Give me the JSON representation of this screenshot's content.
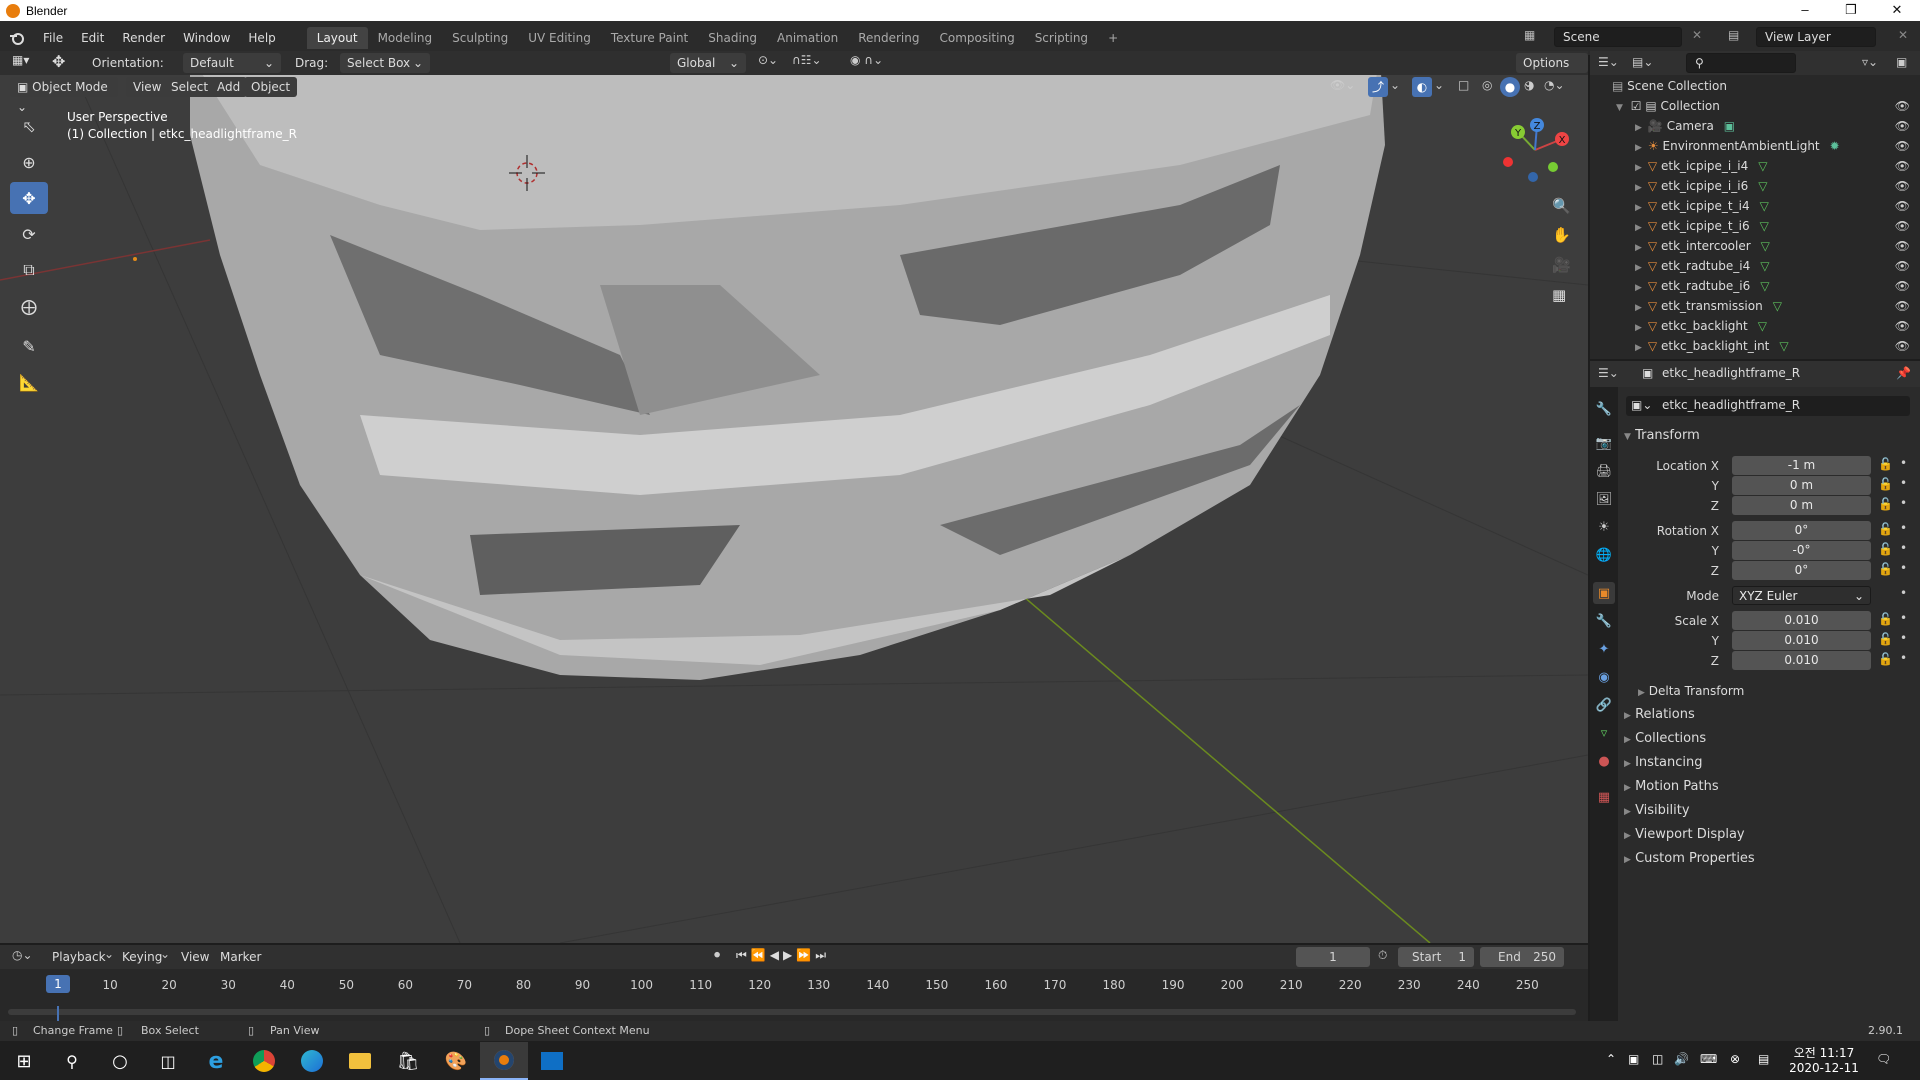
{
  "window": {
    "title": "Blender",
    "minimize": "–",
    "maximize": "❒",
    "close": "✕"
  },
  "menu": [
    "File",
    "Edit",
    "Render",
    "Window",
    "Help"
  ],
  "workspaces": [
    "Layout",
    "Modeling",
    "Sculpting",
    "UV Editing",
    "Texture Paint",
    "Shading",
    "Animation",
    "Rendering",
    "Compositing",
    "Scripting",
    "+"
  ],
  "active_workspace": "Layout",
  "scene": {
    "name": "Scene",
    "view_layer": "View Layer"
  },
  "tool_header": {
    "orientation_label": "Orientation:",
    "orientation_value": "Default",
    "drag_label": "Drag:",
    "drag_value": "Select Box",
    "transform_space": "Global",
    "options": "Options"
  },
  "viewport_header": {
    "mode": "Object Mode",
    "view": "View",
    "select": "Select",
    "add": "Add",
    "object": "Object"
  },
  "viewport": {
    "perspective": "User Perspective",
    "collection_info": "(1) Collection | etkc_headlightframe_R",
    "axis_x": "X",
    "axis_y": "Y",
    "axis_z": "Z"
  },
  "outliner": {
    "root": "Scene Collection",
    "collection": "Collection",
    "items": [
      {
        "name": "Camera",
        "type": "camera"
      },
      {
        "name": "EnvironmentAmbientLight",
        "type": "light"
      },
      {
        "name": "etk_icpipe_i_i4",
        "type": "mesh"
      },
      {
        "name": "etk_icpipe_i_i6",
        "type": "mesh"
      },
      {
        "name": "etk_icpipe_t_i4",
        "type": "mesh"
      },
      {
        "name": "etk_icpipe_t_i6",
        "type": "mesh"
      },
      {
        "name": "etk_intercooler",
        "type": "mesh"
      },
      {
        "name": "etk_radtube_i4",
        "type": "mesh"
      },
      {
        "name": "etk_radtube_i6",
        "type": "mesh"
      },
      {
        "name": "etk_transmission",
        "type": "mesh"
      },
      {
        "name": "etkc_backlight",
        "type": "mesh"
      },
      {
        "name": "etkc_backlight_int",
        "type": "mesh"
      }
    ]
  },
  "properties": {
    "context_object": "etkc_headlightframe_R",
    "object_name": "etkc_headlightframe_R",
    "transform_header": "Transform",
    "location": {
      "label_x": "Location X",
      "x": "-1 m",
      "y": "0 m",
      "z": "0 m"
    },
    "rotation": {
      "label_x": "Rotation X",
      "x": "0°",
      "y": "-0°",
      "z": "0°"
    },
    "mode_label": "Mode",
    "mode_value": "XYZ Euler",
    "scale": {
      "label_x": "Scale X",
      "x": "0.010",
      "y": "0.010",
      "z": "0.010"
    },
    "label_y": "Y",
    "label_z": "Z",
    "delta": "Delta Transform",
    "sections": [
      "Relations",
      "Collections",
      "Instancing",
      "Motion Paths",
      "Visibility",
      "Viewport Display",
      "Custom Properties"
    ]
  },
  "timeline": {
    "playback": "Playback",
    "keying": "Keying",
    "view": "View",
    "marker": "Marker",
    "current_frame": "1",
    "start_label": "Start",
    "start": "1",
    "end_label": "End",
    "end": "250",
    "ticks": [
      "10",
      "20",
      "30",
      "40",
      "50",
      "60",
      "70",
      "80",
      "90",
      "100",
      "110",
      "120",
      "130",
      "140",
      "150",
      "160",
      "170",
      "180",
      "190",
      "200",
      "210",
      "220",
      "230",
      "240",
      "250"
    ],
    "cursor_frame": "1"
  },
  "statusbar": {
    "change_frame": "Change Frame",
    "box_select": "Box Select",
    "pan_view": "Pan View",
    "context_menu": "Dope Sheet Context Menu",
    "version": "2.90.1"
  },
  "taskbar": {
    "time": "오전 11:17",
    "date": "2020-12-11"
  }
}
